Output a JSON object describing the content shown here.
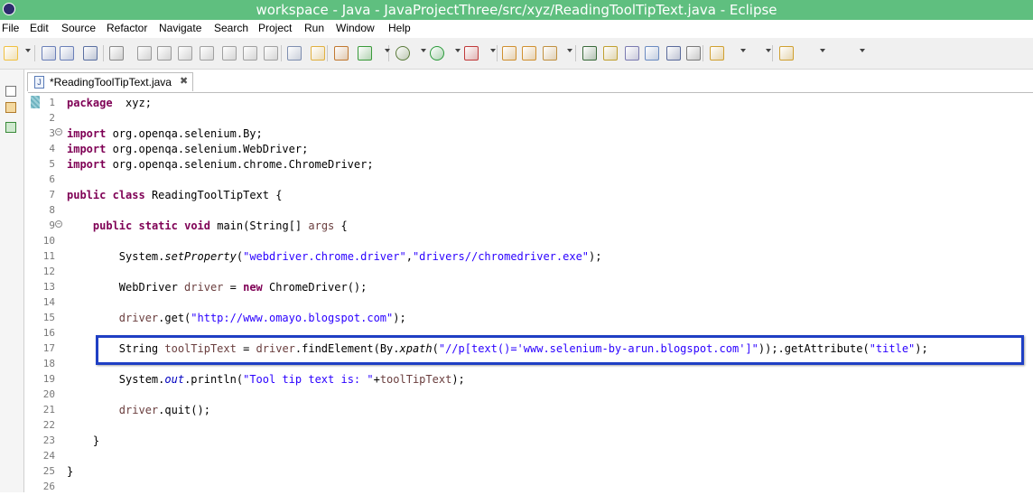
{
  "window": {
    "title": "workspace - Java - JavaProjectThree/src/xyz/ReadingToolTipText.java - Eclipse"
  },
  "menu": [
    "File",
    "Edit",
    "Source",
    "Refactor",
    "Navigate",
    "Search",
    "Project",
    "Run",
    "Window",
    "Help"
  ],
  "editor_tab": {
    "label": "*ReadingToolTipText.java",
    "close": "✖"
  },
  "colors": {
    "titlebar": "#5fbf7f",
    "keyword": "#7f0055",
    "string": "#2a00ff",
    "field": "#0000c0",
    "highlight_box": "#1f3fc4"
  },
  "toolbar_icons": [
    "new-icon",
    "save-icon",
    "save-all-icon",
    "print-icon",
    "skip-breakpoints-icon",
    "resume-icon",
    "suspend-icon",
    "terminate-icon",
    "disconnect-icon",
    "step-into-icon",
    "step-over-icon",
    "step-return-icon",
    "drop-to-frame-icon",
    "use-step-filters-icon",
    "new-java-package-icon",
    "new-java-class-icon",
    "debug-icon",
    "run-icon",
    "external-tools-icon",
    "open-type-icon",
    "open-task-icon",
    "search-icon",
    "toggle-mark-occurrences-icon",
    "toggle-block-selection-icon",
    "show-whitespace-icon",
    "next-annotation-icon",
    "previous-annotation-icon",
    "last-edit-location-icon",
    "back-icon",
    "forward-icon"
  ],
  "code": {
    "lines": [
      {
        "n": "1",
        "t": [
          [
            "kw",
            "package"
          ],
          [
            "",
            "  xyz;"
          ]
        ]
      },
      {
        "n": "2",
        "t": []
      },
      {
        "n": "3",
        "fold": true,
        "t": [
          [
            "kw",
            "import"
          ],
          [
            "",
            " org.openqa.selenium.By;"
          ]
        ]
      },
      {
        "n": "4",
        "t": [
          [
            "kw",
            "import"
          ],
          [
            "",
            " org.openqa.selenium.WebDriver;"
          ]
        ]
      },
      {
        "n": "5",
        "t": [
          [
            "kw",
            "import"
          ],
          [
            "",
            " org.openqa.selenium.chrome.ChromeDriver;"
          ]
        ]
      },
      {
        "n": "6",
        "t": []
      },
      {
        "n": "7",
        "t": [
          [
            "kw",
            "public"
          ],
          [
            "",
            " "
          ],
          [
            "kw",
            "class"
          ],
          [
            "",
            " ReadingToolTipText {"
          ]
        ]
      },
      {
        "n": "8",
        "t": []
      },
      {
        "n": "9",
        "fold": true,
        "t": [
          [
            "",
            "    "
          ],
          [
            "kw",
            "public"
          ],
          [
            "",
            " "
          ],
          [
            "kw",
            "static"
          ],
          [
            "",
            " "
          ],
          [
            "kw",
            "void"
          ],
          [
            "",
            " main(String[] "
          ],
          [
            "var",
            "args"
          ],
          [
            "",
            " {"
          ]
        ]
      },
      {
        "n": "10",
        "t": []
      },
      {
        "n": "11",
        "t": [
          [
            "",
            "        System."
          ],
          [
            "it",
            "setProperty"
          ],
          [
            "",
            "("
          ],
          [
            "str",
            "\"webdriver.chrome.driver\""
          ],
          [
            "",
            ","
          ],
          [
            "str",
            "\"drivers//chromedriver.exe\""
          ],
          [
            "",
            ");"
          ]
        ]
      },
      {
        "n": "12",
        "t": []
      },
      {
        "n": "13",
        "t": [
          [
            "",
            "        WebDriver "
          ],
          [
            "var",
            "driver"
          ],
          [
            "",
            " = "
          ],
          [
            "kw",
            "new"
          ],
          [
            "",
            " ChromeDriver();"
          ]
        ]
      },
      {
        "n": "14",
        "t": []
      },
      {
        "n": "15",
        "t": [
          [
            "",
            "        "
          ],
          [
            "var",
            "driver"
          ],
          [
            "",
            ".get("
          ],
          [
            "str",
            "\"http://www.omayo.blogspot.com\""
          ],
          [
            "",
            ");"
          ]
        ]
      },
      {
        "n": "16",
        "t": []
      },
      {
        "n": "17",
        "t": [
          [
            "",
            "        String "
          ],
          [
            "var",
            "toolTipText"
          ],
          [
            "",
            " = "
          ],
          [
            "var",
            "driver"
          ],
          [
            "",
            ".findElement(By."
          ],
          [
            "it",
            "xpath"
          ],
          [
            "",
            "("
          ],
          [
            "str",
            "\"//p[text()='www.selenium-by-arun.blogspot.com']\""
          ],
          [
            "",
            "));.getAttribute("
          ],
          [
            "str",
            "\"title\""
          ],
          [
            "",
            ");"
          ]
        ]
      },
      {
        "n": "18",
        "t": []
      },
      {
        "n": "19",
        "t": [
          [
            "",
            "        System."
          ],
          [
            "fld it",
            "out"
          ],
          [
            "",
            ".println("
          ],
          [
            "str",
            "\"Tool tip text is: \""
          ],
          [
            "",
            "+"
          ],
          [
            "var",
            "toolTipText"
          ],
          [
            "",
            ");"
          ]
        ]
      },
      {
        "n": "20",
        "t": []
      },
      {
        "n": "21",
        "t": [
          [
            "",
            "        "
          ],
          [
            "var",
            "driver"
          ],
          [
            "",
            ".quit();"
          ]
        ]
      },
      {
        "n": "22",
        "t": []
      },
      {
        "n": "23",
        "t": [
          [
            "",
            "    }"
          ]
        ]
      },
      {
        "n": "24",
        "t": []
      },
      {
        "n": "25",
        "t": [
          [
            "",
            "}"
          ]
        ]
      },
      {
        "n": "26",
        "t": []
      }
    ]
  }
}
